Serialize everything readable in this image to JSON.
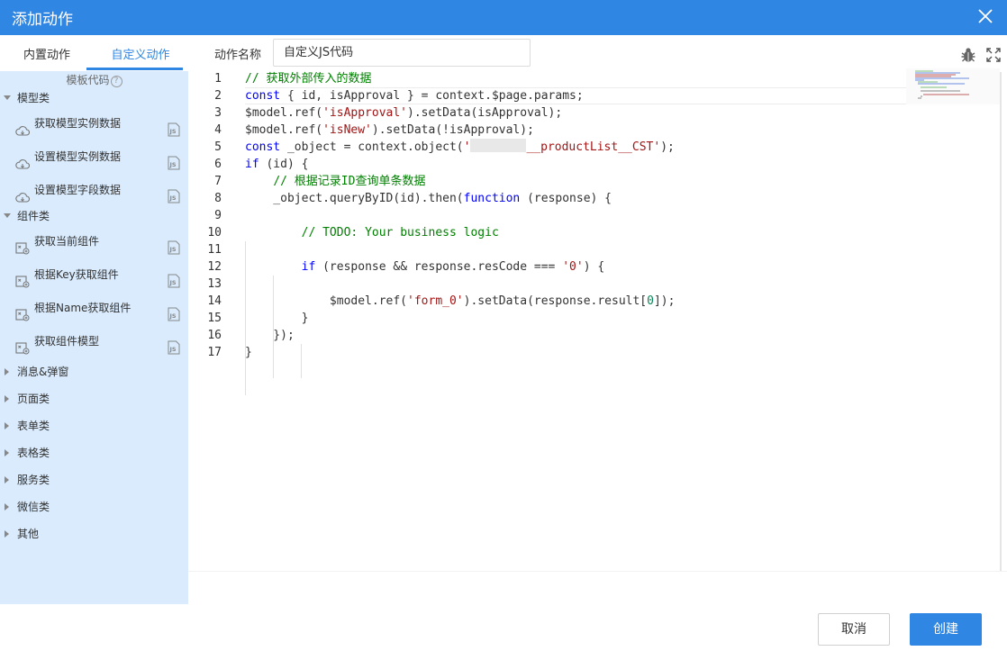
{
  "window": {
    "title": "添加动作"
  },
  "sidebar": {
    "tabs": [
      {
        "label": "内置动作"
      },
      {
        "label": "自定义动作"
      }
    ],
    "template_header": "模板代码",
    "help_glyph": "?",
    "groups": [
      {
        "label": "模型类",
        "expanded": true,
        "items": [
          {
            "label": "获取模型实例数据",
            "icon": "cloud-icon"
          },
          {
            "label": "设置模型实例数据",
            "icon": "cloud-icon"
          },
          {
            "label": "设置模型字段数据",
            "icon": "cloud-icon"
          }
        ]
      },
      {
        "label": "组件类",
        "expanded": true,
        "items": [
          {
            "label": "获取当前组件",
            "icon": "component-icon"
          },
          {
            "label": "根据Key获取组件",
            "icon": "component-icon"
          },
          {
            "label": "根据Name获取组件",
            "icon": "component-icon"
          },
          {
            "label": "获取组件模型",
            "icon": "component-icon"
          }
        ]
      },
      {
        "label": "消息&弹窗",
        "expanded": false
      },
      {
        "label": "页面类",
        "expanded": false
      },
      {
        "label": "表单类",
        "expanded": false
      },
      {
        "label": "表格类",
        "expanded": false
      },
      {
        "label": "服务类",
        "expanded": false
      },
      {
        "label": "微信类",
        "expanded": false
      },
      {
        "label": "其他",
        "expanded": false
      }
    ],
    "item_badge_icon": "js-file-icon"
  },
  "form": {
    "name_label": "动作名称",
    "name_value": "自定义JS代码"
  },
  "toolbar": {
    "debug_icon": "bug-icon",
    "fullscreen_icon": "fullscreen-icon"
  },
  "editor": {
    "current_line": 2,
    "line_numbers": [
      "1",
      "2",
      "3",
      "4",
      "5",
      "6",
      "7",
      "8",
      "9",
      "10",
      "11",
      "12",
      "13",
      "14",
      "15",
      "16",
      "17"
    ],
    "lines": [
      [
        {
          "t": "// 获取外部传入的数据",
          "c": "cm"
        }
      ],
      [
        {
          "t": "const",
          "c": "kw"
        },
        {
          "t": " { id, isApproval } = context.$page.params;",
          "c": ""
        }
      ],
      [
        {
          "t": "$model.ref(",
          "c": ""
        },
        {
          "t": "'isApproval'",
          "c": "str"
        },
        {
          "t": ").setData(isApproval);",
          "c": ""
        }
      ],
      [
        {
          "t": "$model.ref(",
          "c": ""
        },
        {
          "t": "'isNew'",
          "c": "str"
        },
        {
          "t": ").setData(!isApproval);",
          "c": ""
        }
      ],
      [
        {
          "t": "const",
          "c": "kw"
        },
        {
          "t": " _object = context.object(",
          "c": ""
        },
        {
          "t": "'",
          "c": "str"
        },
        {
          "t": "",
          "c": "redact"
        },
        {
          "t": "__productList__CST'",
          "c": "str"
        },
        {
          "t": ");",
          "c": ""
        }
      ],
      [
        {
          "t": "if",
          "c": "kw"
        },
        {
          "t": " (id) {",
          "c": ""
        }
      ],
      [
        {
          "t": "    ",
          "c": ""
        },
        {
          "t": "// 根据记录ID查询单条数据",
          "c": "cm"
        }
      ],
      [
        {
          "t": "    _object.queryByID(id).then(",
          "c": ""
        },
        {
          "t": "function",
          "c": "kw"
        },
        {
          "t": " (response) {",
          "c": ""
        }
      ],
      [
        {
          "t": "",
          "c": ""
        }
      ],
      [
        {
          "t": "        ",
          "c": ""
        },
        {
          "t": "// TODO: Your business logic",
          "c": "cm"
        }
      ],
      [
        {
          "t": "",
          "c": ""
        }
      ],
      [
        {
          "t": "        ",
          "c": ""
        },
        {
          "t": "if",
          "c": "kw"
        },
        {
          "t": " (response && response.resCode === ",
          "c": ""
        },
        {
          "t": "'0'",
          "c": "str"
        },
        {
          "t": ") {",
          "c": ""
        }
      ],
      [
        {
          "t": "",
          "c": ""
        }
      ],
      [
        {
          "t": "            $model.ref(",
          "c": ""
        },
        {
          "t": "'form_0'",
          "c": "str"
        },
        {
          "t": ").setData(response.result[",
          "c": ""
        },
        {
          "t": "0",
          "c": "num"
        },
        {
          "t": "]);",
          "c": ""
        }
      ],
      [
        {
          "t": "        }",
          "c": ""
        }
      ],
      [
        {
          "t": "    });",
          "c": ""
        }
      ],
      [
        {
          "t": "}",
          "c": ""
        }
      ]
    ]
  },
  "footer": {
    "cancel_label": "取消",
    "create_label": "创建"
  },
  "colors": {
    "primary": "#2f86e3",
    "sidebar_bg": "#d9ebfd",
    "keyword": "#0000ff",
    "string": "#a31515",
    "comment": "#008000"
  }
}
